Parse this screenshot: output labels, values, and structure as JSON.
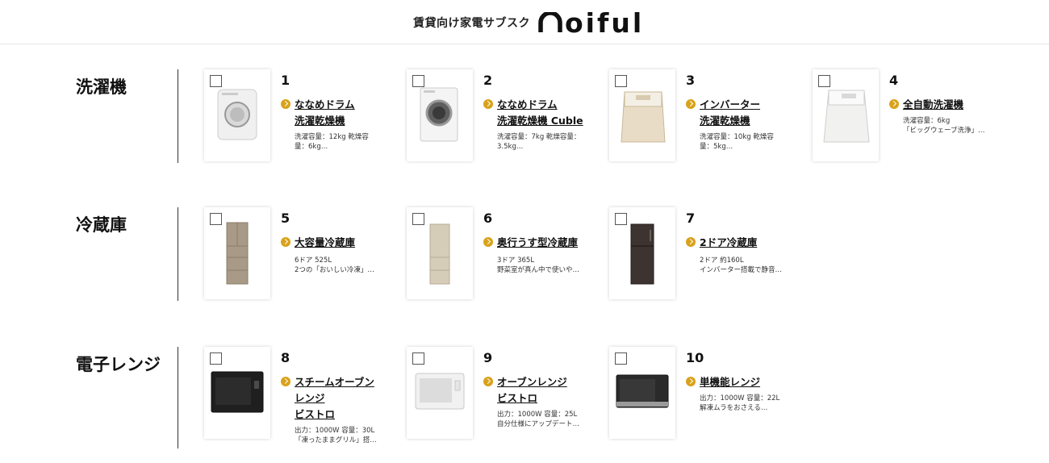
{
  "header": {
    "tagline": "賃貸向け家電サブスク",
    "logo_text": "oiful"
  },
  "colors": {
    "accent": "#d9a21b",
    "divider": "#333333"
  },
  "categories": [
    {
      "title": "洗濯機",
      "products": [
        {
          "num": "1",
          "name_lines": [
            "ななめドラム",
            "洗濯乾燥機"
          ],
          "desc_lines": [
            "洗濯容量：12kg 乾燥容",
            "量：6kg…"
          ]
        },
        {
          "num": "2",
          "name_lines": [
            "ななめドラム",
            "洗濯乾燥機 Cuble"
          ],
          "desc_lines": [
            "洗濯容量：7kg 乾燥容量：",
            "3.5kg…"
          ]
        },
        {
          "num": "3",
          "name_lines": [
            "インバーター",
            "洗濯乾燥機"
          ],
          "desc_lines": [
            "洗濯容量：10kg 乾燥容",
            "量：5kg…"
          ]
        },
        {
          "num": "4",
          "name_lines": [
            "全自動洗濯機"
          ],
          "desc_lines": [
            "洗濯容量：6kg",
            "「ビッグウェーブ洗浄」…"
          ]
        }
      ]
    },
    {
      "title": "冷蔵庫",
      "products": [
        {
          "num": "5",
          "name_lines": [
            "大容量冷蔵庫"
          ],
          "desc_lines": [
            "6ドア 525L",
            "2つの「おいしい冷凍」…"
          ]
        },
        {
          "num": "6",
          "name_lines": [
            "奥行うす型冷蔵庫"
          ],
          "desc_lines": [
            "3ドア 365L",
            "野菜室が真ん中で使いや…"
          ]
        },
        {
          "num": "7",
          "name_lines": [
            "2ドア冷蔵庫"
          ],
          "desc_lines": [
            "2ドア 約160L",
            "インバーター搭載で静音…"
          ]
        }
      ]
    },
    {
      "title": "電子レンジ",
      "products": [
        {
          "num": "8",
          "name_lines": [
            "スチームオーブン",
            "レンジ",
            "ビストロ"
          ],
          "desc_lines": [
            "出力：1000W 容量：30L",
            "「凍ったままグリル」搭…"
          ]
        },
        {
          "num": "9",
          "name_lines": [
            "オーブンレンジ",
            "ビストロ"
          ],
          "desc_lines": [
            "出力：1000W 容量：25L",
            "自分仕様にアップデート…"
          ]
        },
        {
          "num": "10",
          "name_lines": [
            "単機能レンジ"
          ],
          "desc_lines": [
            "出力：1000W 容量：22L",
            "解凍ムラをおさえる…"
          ]
        }
      ]
    }
  ]
}
